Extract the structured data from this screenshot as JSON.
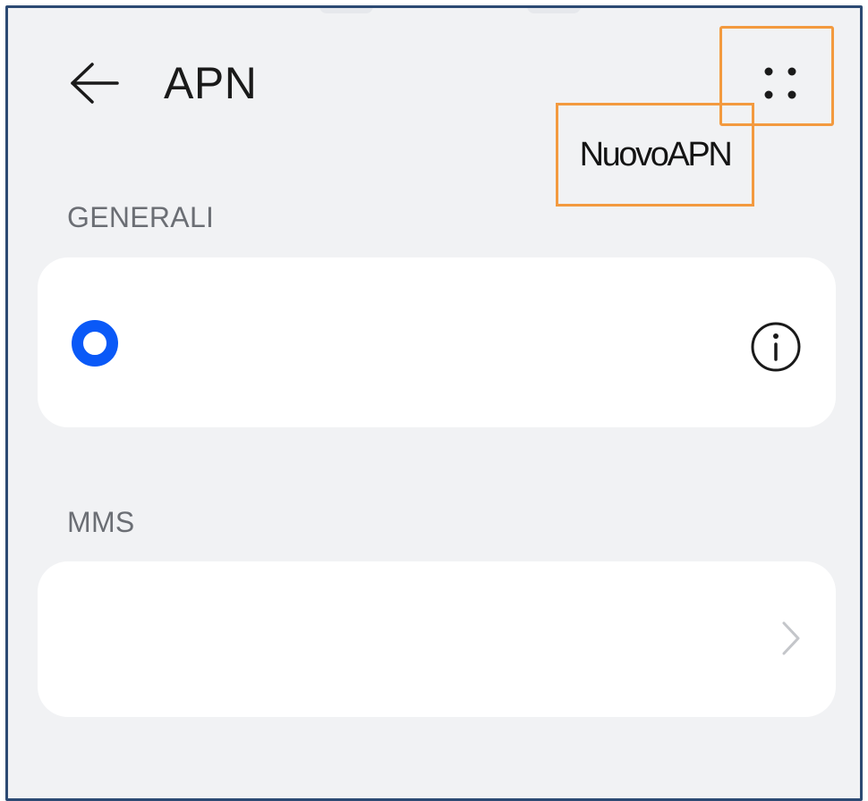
{
  "header": {
    "title": "APN",
    "back_icon": "arrow-left-icon",
    "more_icon": "four-dots-menu-icon"
  },
  "menu": {
    "new_apn_label": "NuovoAPN"
  },
  "sections": {
    "general": {
      "title": "GENERALI",
      "radio_selected": true,
      "info_icon": "info-circle-icon"
    },
    "mms": {
      "title": "MMS",
      "chevron_icon": "chevron-right-icon"
    }
  },
  "colors": {
    "background": "#f1f2f4",
    "card": "#ffffff",
    "accent_blue": "#0a59f7",
    "highlight_orange": "#f39a3f",
    "frame_border": "#2c4a73",
    "title_text": "#1a1a1a",
    "section_text": "#6b6e74"
  }
}
